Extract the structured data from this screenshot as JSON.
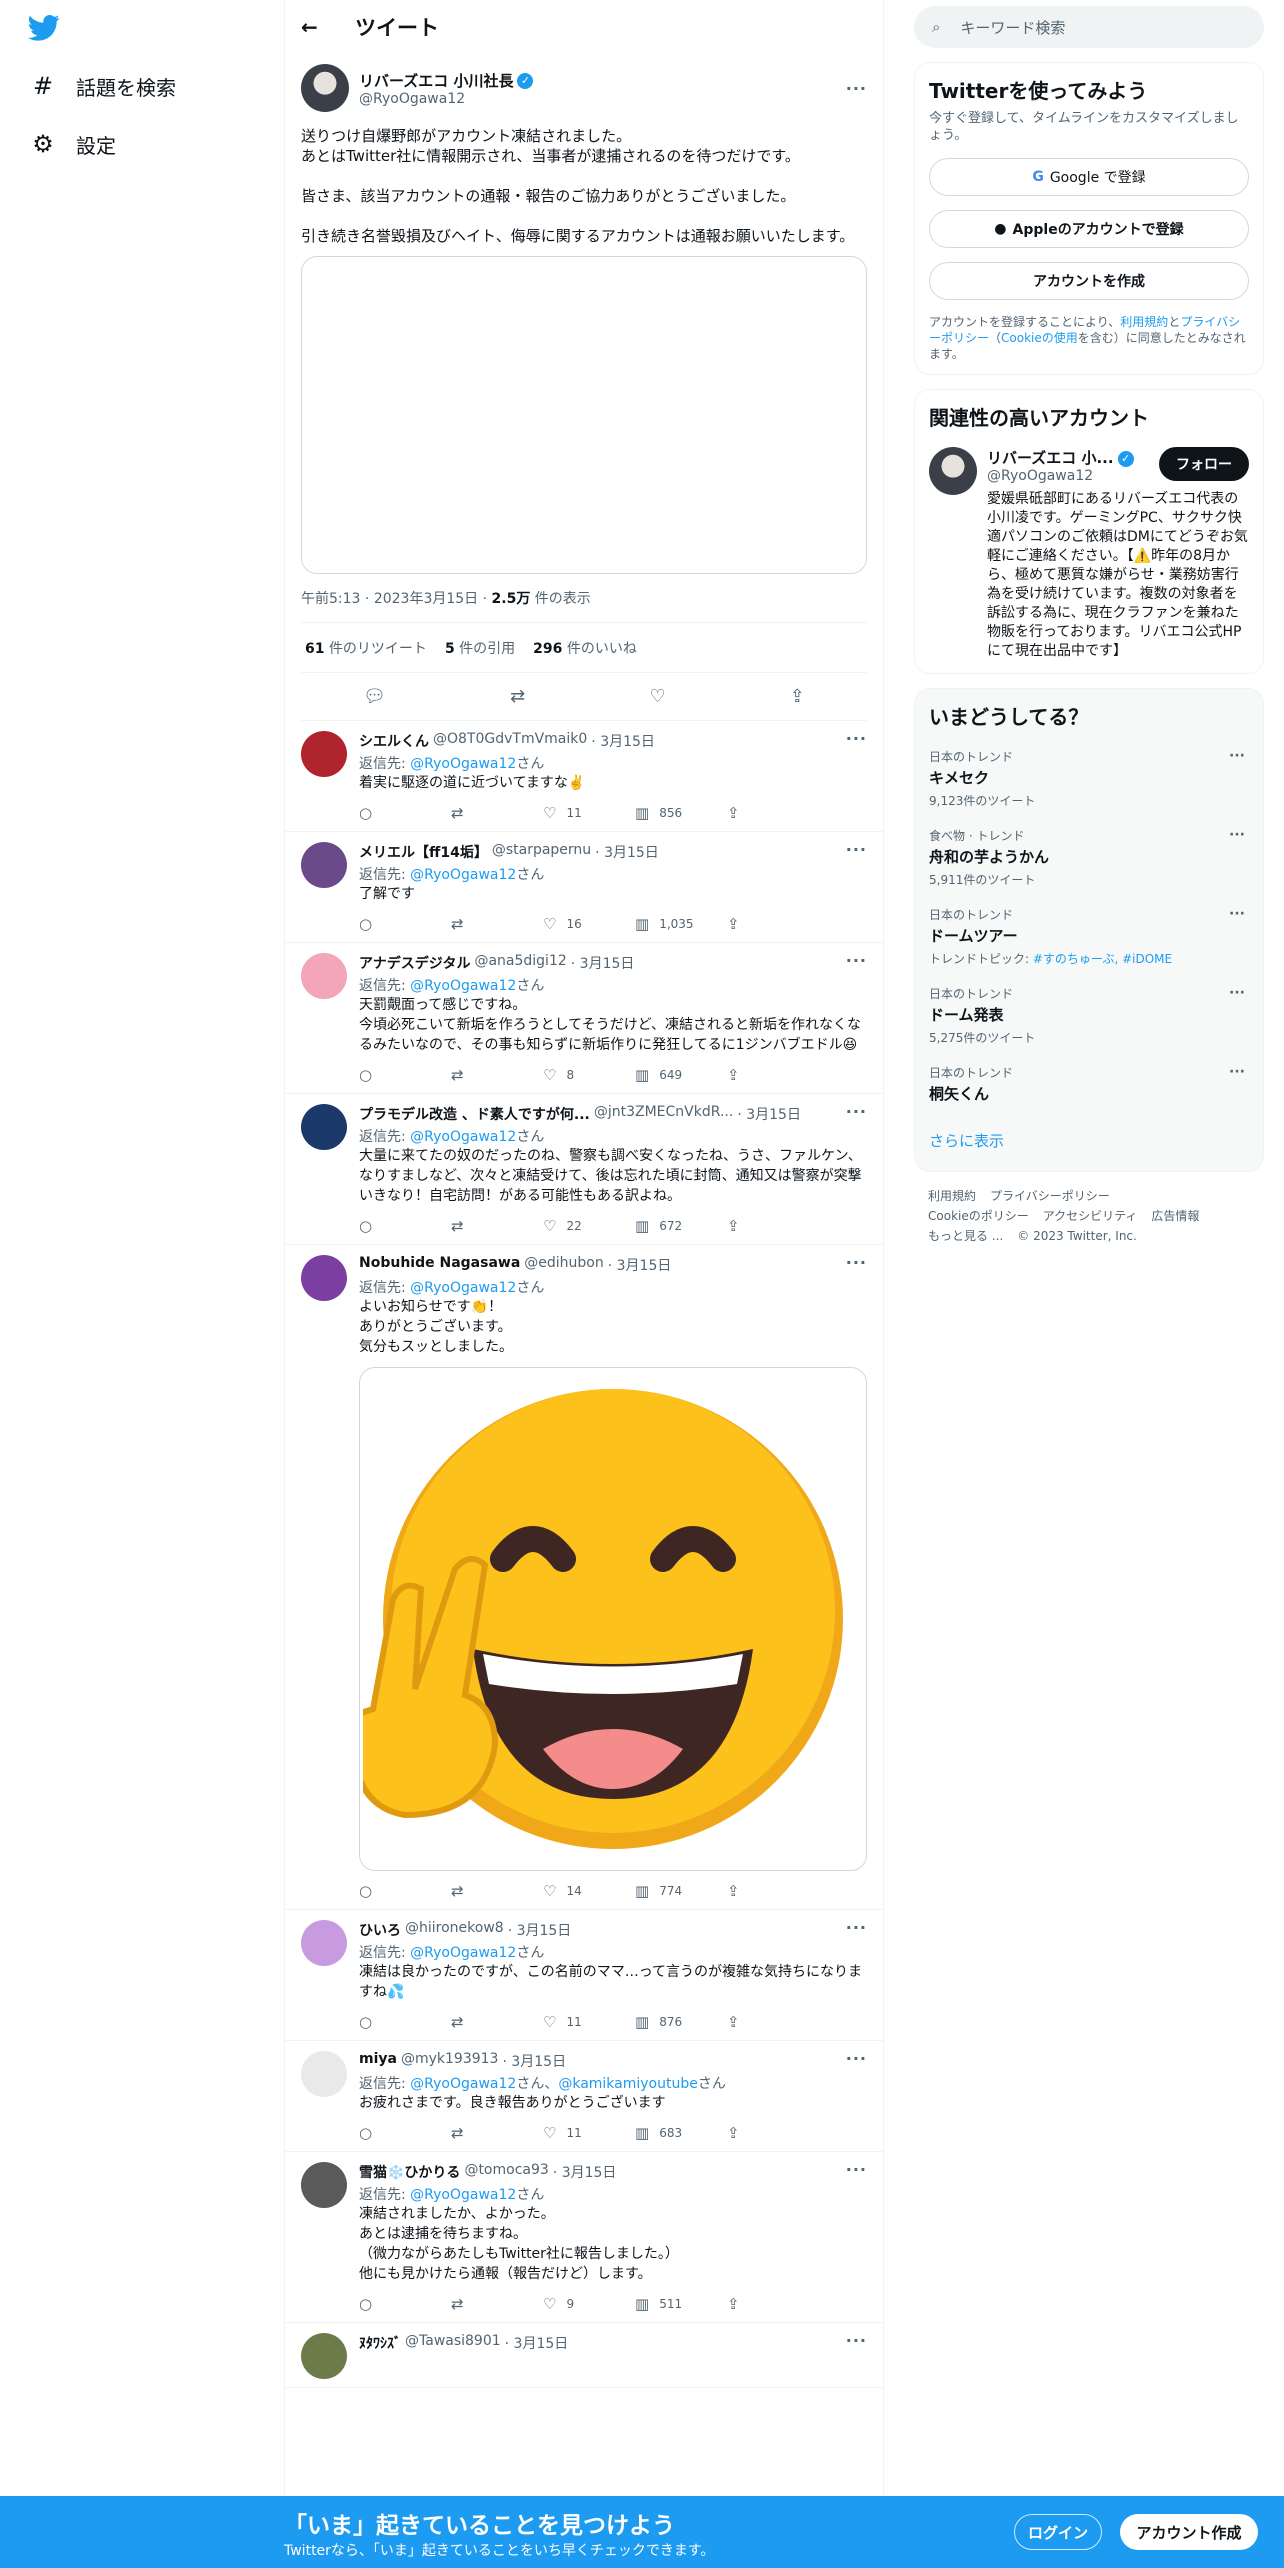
{
  "nav": {
    "explore_label": "話題を検索",
    "settings_label": "設定"
  },
  "header": {
    "title": "ツイート"
  },
  "main_tweet": {
    "name": "リバーズエコ 小川社長",
    "handle": "@RyoOgawa12",
    "text": "送りつけ自爆野郎がアカウント凍結されました。\nあとはTwitter社に情報開示され、当事者が逮捕されるのを待つだけです。\n\n皆さま、該当アカウントの通報・報告のご協力ありがとうございました。\n\n引き続き名誉毀損及びヘイト、侮辱に関するアカウントは通報お願いいたします。",
    "time": "午前5:13",
    "date": "2023年3月15日",
    "views": "2.5万",
    "views_label": "件の表示",
    "retweets": "61",
    "retweets_label": "件のリツイート",
    "quotes": "5",
    "quotes_label": "件の引用",
    "likes": "296",
    "likes_label": "件のいいね"
  },
  "reply_to_label": "返信先:",
  "san": "さん",
  "replies": [
    {
      "name": "シエルくん",
      "handle": "@O8T0GdvTmVmaik0",
      "date": "· 3月15日",
      "to": "@RyoOgawa12",
      "to2": "",
      "text": "着実に駆逐の道に近づいてますな✌️",
      "likes": "11",
      "views": "856"
    },
    {
      "name": "メリエル【ff14垢】",
      "handle": "@starpapernu",
      "date": "· 3月15日",
      "to": "@RyoOgawa12",
      "to2": "",
      "text": "了解です",
      "likes": "16",
      "views": "1,035"
    },
    {
      "name": "アナデスデジタル",
      "handle": "@ana5digi12",
      "date": "· 3月15日",
      "to": "@RyoOgawa12",
      "to2": "",
      "text": "天罰覿面って感じですね。\n今頃必死こいて新垢を作ろうとしてそうだけど、凍結されると新垢を作れなくなるみたいなので、その事も知らずに新垢作りに発狂してるに1ジンバブエドル😆",
      "likes": "8",
      "views": "649"
    },
    {
      "name": "プラモデル改造 、ド素人ですが何...",
      "handle": "@jnt3ZMECnVkdR...",
      "date": "· 3月15日",
      "to": "@RyoOgawa12",
      "to2": "",
      "text": "大量に来てたの奴のだったのね、警察も調べ安くなったね、うさ、ファルケン、なりすましなど、次々と凍結受けて、後は忘れた頃に封筒、通知又は警察が突撃いきなり！自宅訪問！がある可能性もある訳よね。",
      "likes": "22",
      "views": "672"
    },
    {
      "name": "Nobuhide Nagasawa",
      "handle": "@edihubon",
      "date": "· 3月15日",
      "to": "@RyoOgawa12",
      "to2": "",
      "text": "よいお知らせです👏！\nありがとうございます。\n気分もスッとしました。",
      "likes": "14",
      "views": "774",
      "has_media": true
    },
    {
      "name": "ひいろ",
      "handle": "@hiironekow8",
      "date": "· 3月15日",
      "to": "@RyoOgawa12",
      "to2": "",
      "text": "凍結は良かったのですが、この名前のママ…って言うのが複雑な気持ちになりますね💦",
      "likes": "11",
      "views": "876"
    },
    {
      "name": "miya",
      "handle": "@myk193913",
      "date": "· 3月15日",
      "to": "@RyoOgawa12",
      "to2": "@kamikamiyoutube",
      "text": "お疲れさまです。良き報告ありがとうございます",
      "likes": "11",
      "views": "683"
    },
    {
      "name": "雪猫❄️ひかりる",
      "handle": "@tomoca93",
      "date": "· 3月15日",
      "to": "@RyoOgawa12",
      "to2": "",
      "text": "凍結されましたか、よかった。\nあとは逮捕を待ちますね。\n（微力ながらあたしもTwitter社に報告しました。）\n他にも見かけたら通報（報告だけど）します。",
      "likes": "9",
      "views": "511"
    },
    {
      "name": "ﾇﾀﾜｼｽﾞ",
      "handle": "@Tawasi8901",
      "date": "· 3月15日",
      "to": "",
      "to2": "",
      "text": "",
      "likes": "",
      "views": ""
    }
  ],
  "right": {
    "search_placeholder": "キーワード検索",
    "signup_title": "Twitterを使ってみよう",
    "signup_sub": "今すぐ登録して、タイムラインをカスタマイズしましょう。",
    "google_btn": "Google で登録",
    "apple_btn": "Appleのアカウントで登録",
    "create_btn": "アカウントを作成",
    "legal_a": "アカウントを登録することにより、",
    "legal_terms": "利用規約",
    "legal_b": "と",
    "legal_privacy": "プライバシーポリシー",
    "legal_c": "（",
    "legal_cookie": "Cookieの使用",
    "legal_d": "を含む）に同意したとみなされます。",
    "related_title": "関連性の高いアカウント",
    "related_name": "リバーズエコ 小...",
    "related_handle": "@RyoOgawa12",
    "follow_btn": "フォロー",
    "related_bio": "愛媛県砥部町にあるリバーズエコ代表の小川凌です。ゲーミングPC、サクサク快適パソコンのご依頼はDMにてどうぞお気軽にご連絡ください。【⚠️昨年の8月から、極めて悪質な嫌がらせ・業務妨害行為を受け続けています。複数の対象者を訴訟する為に、現在クラファンを兼ねた物販を行っております。リバエコ公式HPにて現在出品中です】",
    "trends_title": "いまどうしてる？",
    "trends": [
      {
        "cat": "日本のトレンド",
        "name": "キメセク",
        "cnt": "9,123件のツイート"
      },
      {
        "cat": "食べ物 · トレンド",
        "name": "舟和の芋ようかん",
        "cnt": "5,911件のツイート"
      },
      {
        "cat": "日本のトレンド",
        "name": "ドームツアー",
        "cnt": "",
        "topic_label": "トレンドトピック:",
        "topic": "#すのちゅーぶ, #iDOME"
      },
      {
        "cat": "日本のトレンド",
        "name": "ドーム発表",
        "cnt": "5,275件のツイート"
      },
      {
        "cat": "日本のトレンド",
        "name": "桐矢くん",
        "cnt": ""
      }
    ],
    "show_more": "さらに表示",
    "footer": [
      "利用規約",
      "プライバシーポリシー",
      "Cookieのポリシー",
      "アクセシビリティ",
      "広告情報",
      "もっと見る ...",
      "© 2023 Twitter, Inc."
    ]
  },
  "bottom": {
    "title": "「いま」起きていることを見つけよう",
    "sub": "Twitterなら、「いま」起きていることをいち早くチェックできます。",
    "login": "ログイン",
    "signup": "アカウント作成"
  },
  "colors": {
    "accent": "#1d9bf0",
    "text": "#0f1419",
    "muted": "#536471"
  }
}
